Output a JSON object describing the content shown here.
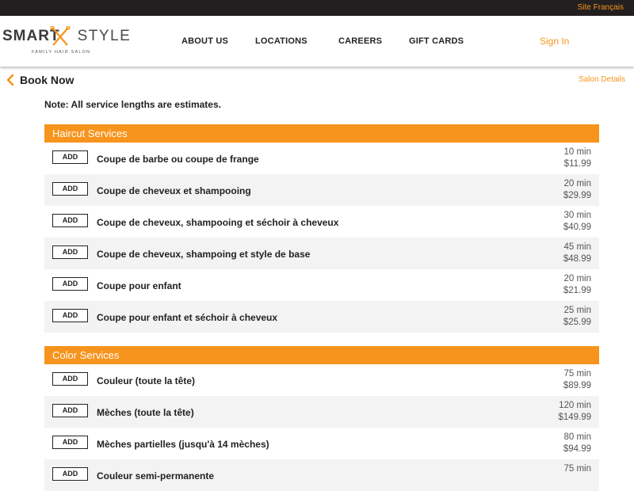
{
  "topbar": {
    "language_link": "Site Français"
  },
  "logo": {
    "brand_smart": "SMART",
    "brand_style": "STYLE",
    "tagline": "FAMILY HAIR SALON"
  },
  "nav": {
    "items": [
      {
        "label": "ABOUT US"
      },
      {
        "label": "LOCATIONS"
      },
      {
        "label": "CAREERS"
      },
      {
        "label": "GIFT CARDS"
      }
    ],
    "sign_in": "Sign In"
  },
  "subheader": {
    "title": "Book Now",
    "salon_details": "Salon Details"
  },
  "note": "Note: All service lengths are estimates.",
  "add_label": "ADD",
  "colors": {
    "accent": "#f7941d",
    "topbar": "#231f20",
    "row_alt": "#f3f3f3"
  },
  "sections": [
    {
      "title": "Haircut Services",
      "services": [
        {
          "name": "Coupe de barbe ou coupe de frange",
          "duration": "10 min",
          "price": "$11.99"
        },
        {
          "name": "Coupe de cheveux et shampooing",
          "duration": "20 min",
          "price": "$29.99"
        },
        {
          "name": "Coupe de cheveux, shampooing et séchoir à cheveux",
          "duration": "30 min",
          "price": "$40.99"
        },
        {
          "name": "Coupe de cheveux, shampoing et style de base",
          "duration": "45 min",
          "price": "$48.99"
        },
        {
          "name": "Coupe pour enfant",
          "duration": "20 min",
          "price": "$21.99"
        },
        {
          "name": "Coupe pour enfant et séchoir à cheveux",
          "duration": "25 min",
          "price": "$25.99"
        }
      ]
    },
    {
      "title": "Color Services",
      "services": [
        {
          "name": "Couleur (toute la tête)",
          "duration": "75 min",
          "price": "$89.99"
        },
        {
          "name": "Mèches (toute la tête)",
          "duration": "120 min",
          "price": "$149.99"
        },
        {
          "name": "Mèches partielles (jusqu'à 14 mèches)",
          "duration": "80 min",
          "price": "$94.99"
        },
        {
          "name": "Couleur semi-permanente",
          "duration": "75 min",
          "price": ""
        }
      ]
    }
  ]
}
